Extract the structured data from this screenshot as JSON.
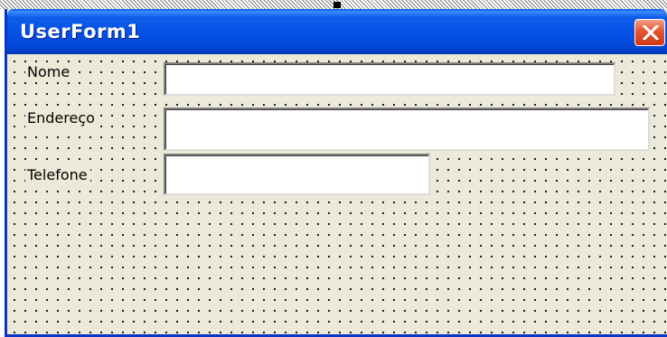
{
  "window": {
    "title": "UserForm1",
    "close_icon": "close-icon"
  },
  "form": {
    "fields": [
      {
        "label": "Nome",
        "value": ""
      },
      {
        "label": "Endereço",
        "value": ""
      },
      {
        "label": "Telefone",
        "value": ""
      }
    ]
  },
  "colors": {
    "titlebar": "#0552e6",
    "close_button": "#e2542f",
    "client_background": "#ece9d8",
    "grid_dots": "#000000"
  }
}
